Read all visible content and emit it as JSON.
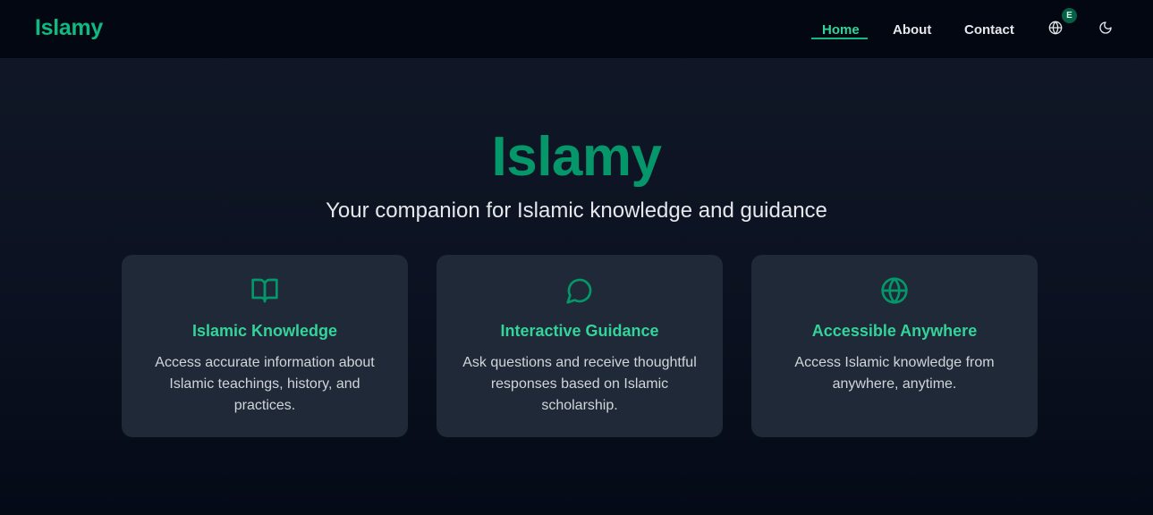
{
  "nav": {
    "brand": "Islamy",
    "links": [
      {
        "label": "Home",
        "active": true
      },
      {
        "label": "About",
        "active": false
      },
      {
        "label": "Contact",
        "active": false
      }
    ],
    "language_badge": "E",
    "language_icon": "globe-icon",
    "theme_icon": "moon-icon"
  },
  "hero": {
    "title": "Islamy",
    "subtitle": "Your companion for Islamic knowledge and guidance"
  },
  "features": [
    {
      "icon": "book-open-icon",
      "title": "Islamic Knowledge",
      "description": "Access accurate information about Islamic teachings, history, and practices."
    },
    {
      "icon": "message-circle-icon",
      "title": "Interactive Guidance",
      "description": "Ask questions and receive thoughtful responses based on Islamic scholarship."
    },
    {
      "icon": "globe-icon",
      "title": "Accessible Anywhere",
      "description": "Access Islamic knowledge from anywhere, anytime."
    }
  ],
  "colors": {
    "accent": "#10b981",
    "accent_light": "#34d399",
    "nav_bg": "#030712",
    "card_bg": "#1f2937"
  }
}
